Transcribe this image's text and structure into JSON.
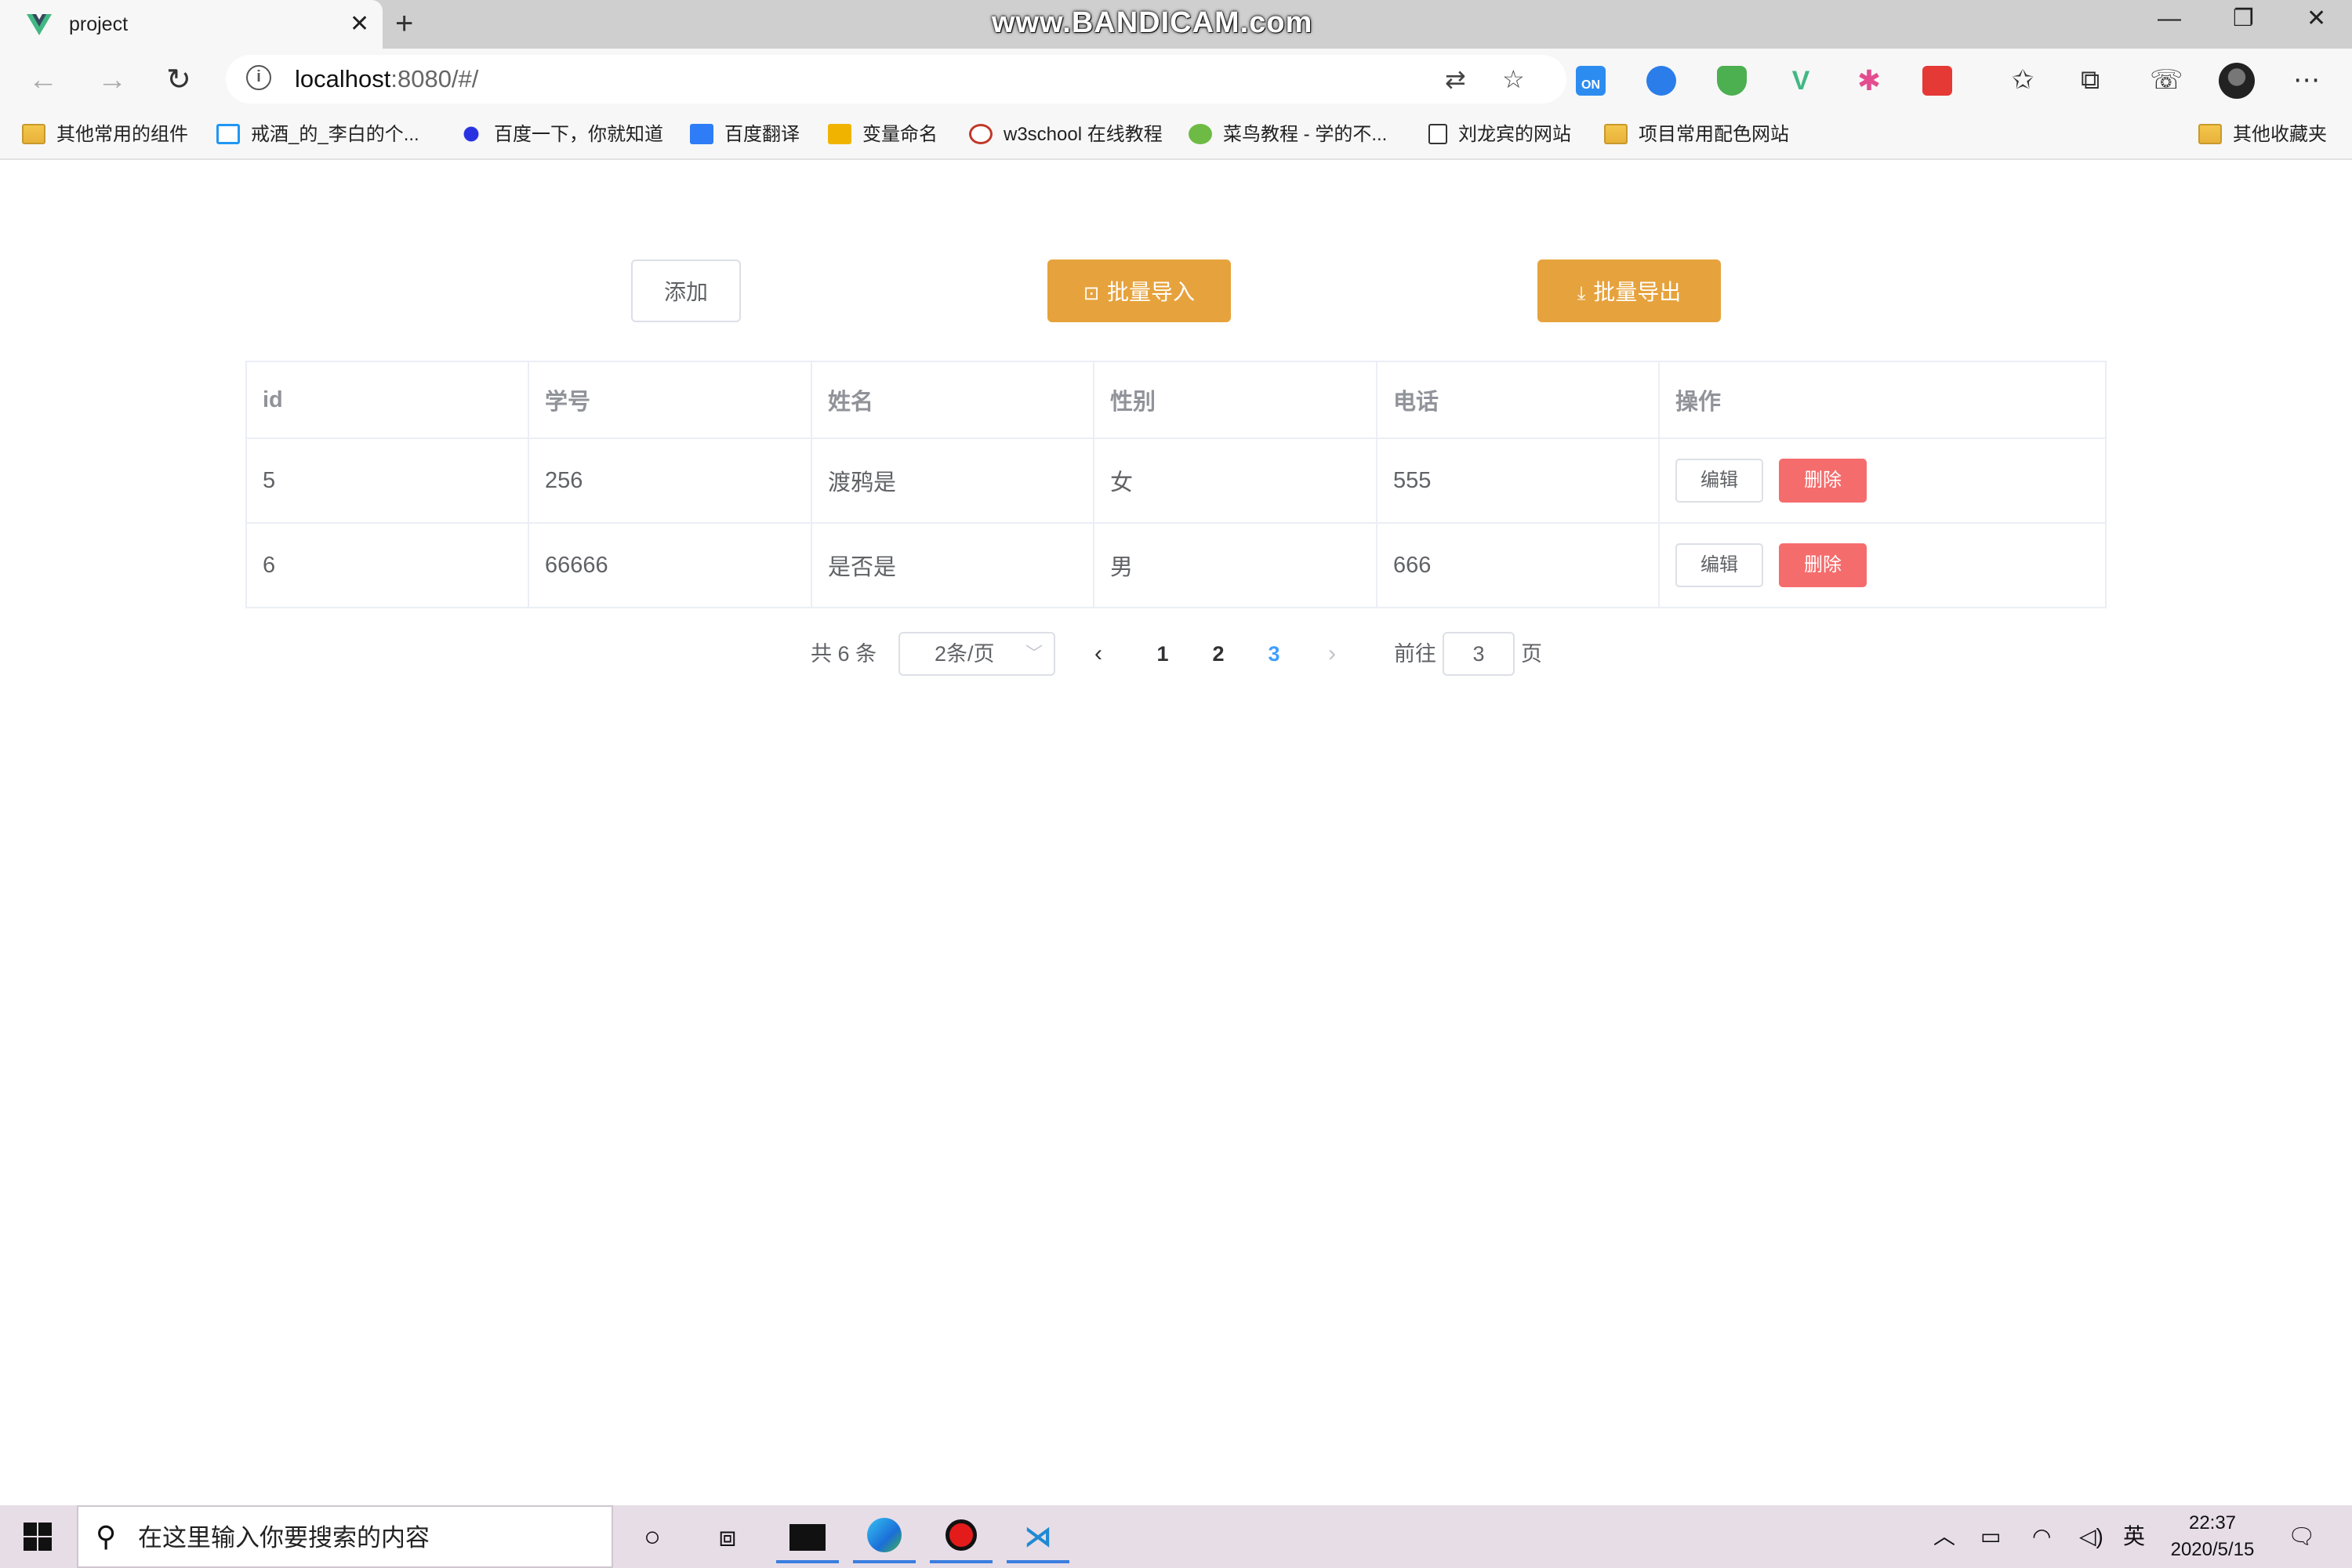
{
  "browser": {
    "tab_title": "project",
    "watermark": "www.BANDICAM.com",
    "url_host": "localhost",
    "url_rest": ":8080/#/",
    "bookmarks": [
      {
        "label": "其他常用的组件",
        "icon": "folder-icon"
      },
      {
        "label": "戒酒_的_李白的个...",
        "icon": "bilibili-icon"
      },
      {
        "label": "百度一下，你就知道",
        "icon": "baidu-icon"
      },
      {
        "label": "百度翻译",
        "icon": "translate-icon"
      },
      {
        "label": "变量命名",
        "icon": "codelf-icon"
      },
      {
        "label": "w3school 在线教程",
        "icon": "w3school-icon"
      },
      {
        "label": "菜鸟教程 - 学的不...",
        "icon": "runoob-icon"
      },
      {
        "label": "刘龙宾的网站",
        "icon": "page-icon"
      },
      {
        "label": "项目常用配色网站",
        "icon": "folder-icon"
      }
    ],
    "other_bookmarks": "其他收藏夹",
    "ext_on_label": "ON"
  },
  "toolbar": {
    "add_label": "添加",
    "import_label": "批量导入",
    "export_label": "批量导出"
  },
  "table": {
    "headers": [
      "id",
      "学号",
      "姓名",
      "性别",
      "电话",
      "操作"
    ],
    "rows": [
      {
        "id": "5",
        "student_no": "256",
        "name": "渡鸦是",
        "gender": "女",
        "phone": "555"
      },
      {
        "id": "6",
        "student_no": "66666",
        "name": "是否是",
        "gender": "男",
        "phone": "666"
      }
    ],
    "edit_label": "编辑",
    "delete_label": "删除"
  },
  "pagination": {
    "total_text": "共 6 条",
    "page_size": "2条/页",
    "pages": [
      "1",
      "2",
      "3"
    ],
    "current_page": "3",
    "goto_prefix": "前往",
    "goto_value": "3",
    "goto_suffix": "页"
  },
  "taskbar": {
    "search_placeholder": "在这里输入你要搜索的内容",
    "ime": "英",
    "time": "22:37",
    "date": "2020/5/15"
  },
  "colors": {
    "warning": "#e6a23c",
    "danger": "#f56c6c",
    "primary": "#409eff"
  }
}
